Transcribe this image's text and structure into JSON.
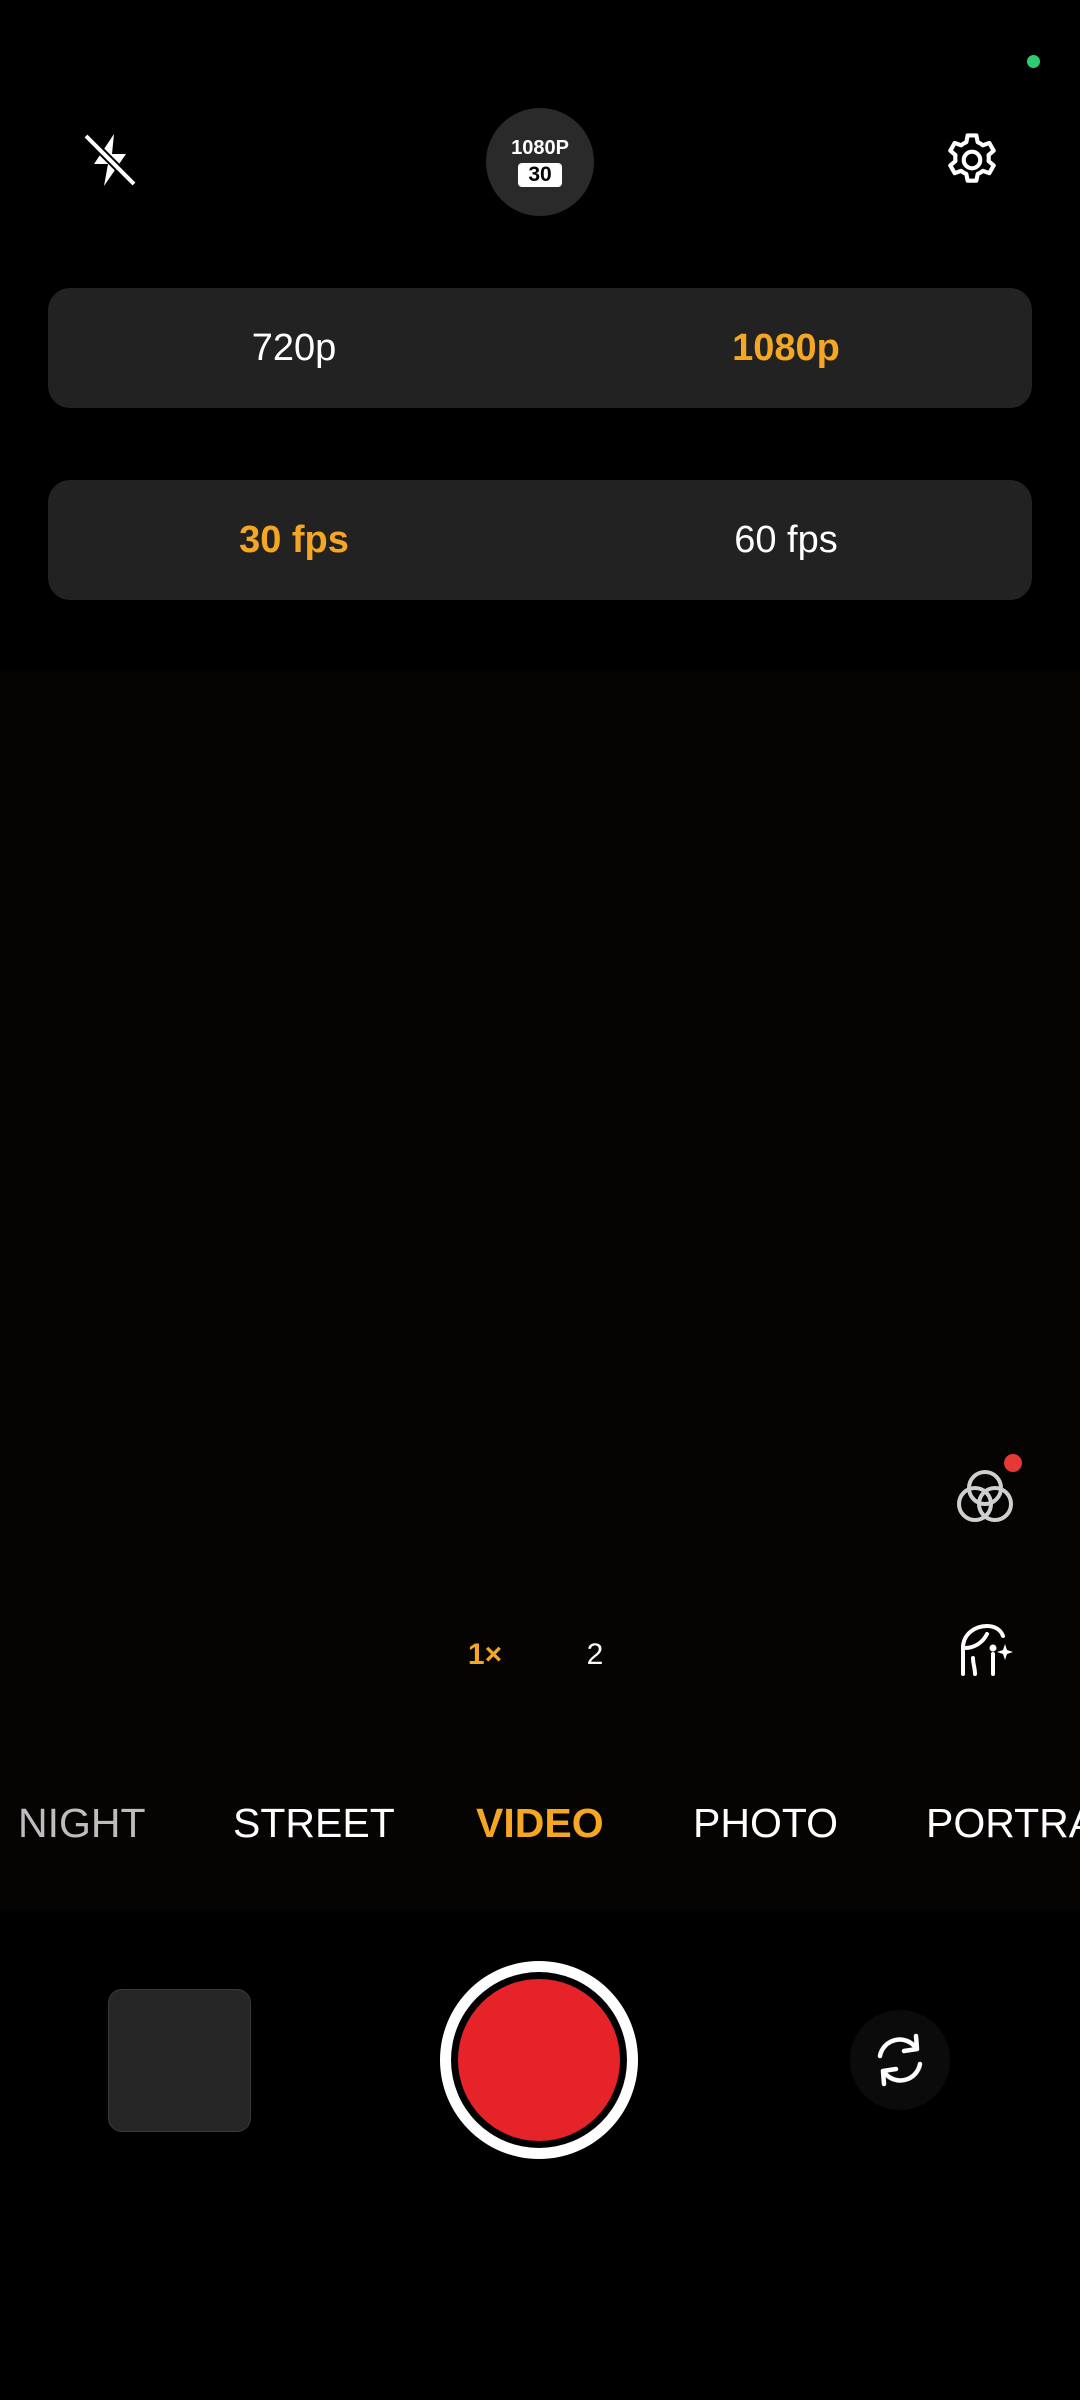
{
  "status": {
    "indicator_color": "#2ecc71"
  },
  "top_bar": {
    "flash_icon": "flash-off-icon",
    "quality_badge": {
      "resolution": "1080P",
      "fps": "30"
    },
    "settings_icon": "gear-icon"
  },
  "resolution_selector": {
    "options": [
      "720p",
      "1080p"
    ],
    "selected": "1080p"
  },
  "fps_selector": {
    "options": [
      "30 fps",
      "60 fps"
    ],
    "selected": "30 fps"
  },
  "side_tools": {
    "filters_icon": "filters-icon",
    "filters_badge_color": "#e53935",
    "beauty_icon": "face-retouch-icon"
  },
  "zoom": {
    "options": [
      "1×",
      "2"
    ],
    "selected": "1×"
  },
  "modes": {
    "items": [
      "NIGHT",
      "STREET",
      "VIDEO",
      "PHOTO",
      "PORTRA"
    ],
    "selected": "VIDEO"
  },
  "bottom_bar": {
    "gallery_icon": "gallery-thumbnail",
    "record_color": "#e52329",
    "flip_icon": "camera-flip-icon"
  },
  "colors": {
    "accent": "#f5a623",
    "panel": "#222222",
    "record": "#e52329"
  }
}
